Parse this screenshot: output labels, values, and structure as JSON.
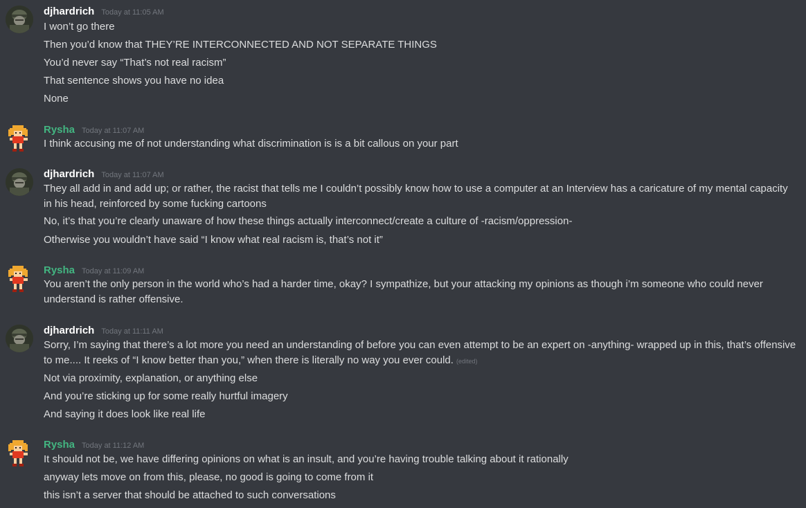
{
  "messages": [
    {
      "author": "djhardrich",
      "author_color": "#ffffff",
      "avatar": "soldier-avatar",
      "timestamp": "Today at 11:05 AM",
      "lines": [
        "I won’t go there",
        "Then you’d know that THEY’RE INTERCONNECTED AND NOT SEPARATE THINGS",
        "You’d never say “That’s not real racism”",
        "That sentence shows you have no idea",
        "None"
      ]
    },
    {
      "author": "Rysha",
      "author_color": "#43b581",
      "avatar": "pixel-girl-avatar",
      "timestamp": "Today at 11:07 AM",
      "lines": [
        "I think accusing me of not understanding what discrimination is is a bit callous on your part"
      ]
    },
    {
      "author": "djhardrich",
      "author_color": "#ffffff",
      "avatar": "soldier-avatar",
      "timestamp": "Today at 11:07 AM",
      "lines": [
        "They all add in and add up; or rather, the racist that tells me I couldn’t possibly know how to use a computer at an Interview has a caricature of my mental capacity in his head, reinforced by some fucking cartoons",
        "No, it’s that you’re clearly unaware of how these things actually interconnect/create a culture of -racism/oppression-",
        "Otherwise you wouldn’t have said “I know what real racism is, that’s not it”"
      ]
    },
    {
      "author": "Rysha",
      "author_color": "#43b581",
      "avatar": "pixel-girl-avatar",
      "timestamp": "Today at 11:09 AM",
      "lines": [
        "You aren’t the only person in the world who’s had a harder time, okay? I sympathize, but your attacking my opinions as though i’m someone who could never understand is rather offensive."
      ]
    },
    {
      "author": "djhardrich",
      "author_color": "#ffffff",
      "avatar": "soldier-avatar",
      "timestamp": "Today at 11:11 AM",
      "lines": [
        "Sorry, I’m saying that there’s a lot more you need an understanding of before you can even attempt to be an expert on -anything- wrapped up in this, that’s offensive to me.... It reeks of “I know better than you,” when there is literally no way you ever could.",
        "Not via proximity, explanation, or anything else",
        "And you’re sticking up for some really hurtful imagery",
        "And saying it does look like real life"
      ],
      "edited_label": "(edited)"
    },
    {
      "author": "Rysha",
      "author_color": "#43b581",
      "avatar": "pixel-girl-avatar",
      "timestamp": "Today at 11:12 AM",
      "lines": [
        "It should not be, we have differing opinions on what is an insult, and you’re having trouble talking about it rationally",
        "anyway lets move on from this, please, no good is going to come from it",
        "this isn’t a server that should be attached to such conversations"
      ]
    }
  ]
}
